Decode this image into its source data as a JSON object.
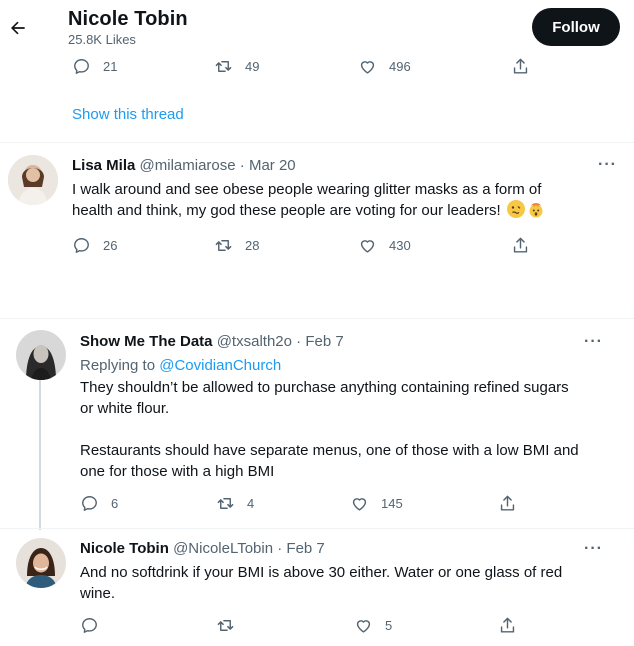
{
  "header": {
    "name": "Nicole Tobin",
    "likes": "25.8K Likes",
    "follow_label": "Follow"
  },
  "top_actions": {
    "replies": "21",
    "retweets": "49",
    "likes": "496"
  },
  "show_thread": "Show this thread",
  "tweets": [
    {
      "name": "Lisa Mila",
      "handle": "@milamiarose",
      "sep": " · ",
      "date": "Mar 20",
      "text_line1": "I walk around and see obese people wearing glitter masks as a form of",
      "text_line2": "health and think, my god these people are voting for our leaders!",
      "replies": "26",
      "retweets": "28",
      "likes": "430",
      "emoji_1": "woozy-face-emoji",
      "emoji_2": "exploding-head-emoji"
    },
    {
      "name": "Show Me The Data",
      "handle": "@txsalth2o",
      "sep": " · ",
      "date": "Feb 7",
      "replying_prefix": "Replying to ",
      "replying_to": "@CovidianChurch",
      "p1_line1": "They shouldn’t be allowed to purchase anything containing refined sugars",
      "p1_line2": "or white flour.",
      "p2_line1": "Restaurants should have separate menus, one of those with a low BMI and",
      "p2_line2": "one for those with a high BMI",
      "replies": "6",
      "retweets": "4",
      "likes": "145"
    },
    {
      "name": "Nicole Tobin",
      "handle": "@NicoleLTobin",
      "sep": " · ",
      "date": "Feb 7",
      "text_line1": "And no softdrink if your BMI is above 30 either. Water or one glass of red",
      "text_line2": "wine.",
      "replies": "",
      "retweets": "",
      "likes": "5"
    }
  ],
  "more_label": "···",
  "colors": {
    "accent": "#1d9bf0",
    "text": "#0f1419",
    "muted": "#536471"
  }
}
